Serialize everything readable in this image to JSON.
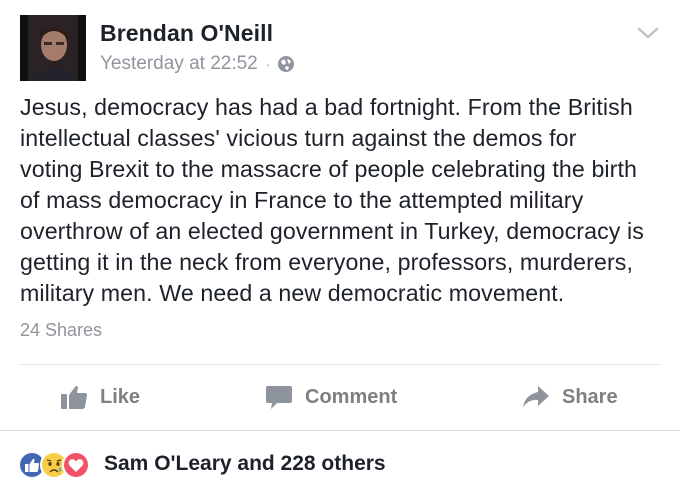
{
  "post": {
    "author": "Brendan O'Neill",
    "timestamp": "Yesterday at 22:52",
    "separator": "·",
    "privacy_icon": "globe-icon",
    "body": "Jesus, democracy has had a bad fortnight. From the British\nintellectual classes' vicious turn against the demos for\nvoting Brexit to the massacre of people celebrating the birth\nof mass democracy in France to the attempted military\noverthrow of an elected government in Turkey, democracy is\ngetting it in the neck from everyone, professors, murderers,\nmilitary men. We need a new democratic movement.",
    "shares": "24 Shares"
  },
  "actions": {
    "like_label": "Like",
    "comment_label": "Comment",
    "share_label": "Share"
  },
  "reactions": {
    "icons": [
      "like-reaction-icon",
      "sad-reaction-icon",
      "love-reaction-icon"
    ],
    "summary": "Sam O'Leary and 228 others"
  },
  "colors": {
    "primary_text": "#1d2129",
    "secondary_text": "#90949c",
    "action_text": "#7f7f7f",
    "like_blue": "#4267b2",
    "love_red": "#f25268",
    "sad_yellow": "#f7cf46"
  }
}
